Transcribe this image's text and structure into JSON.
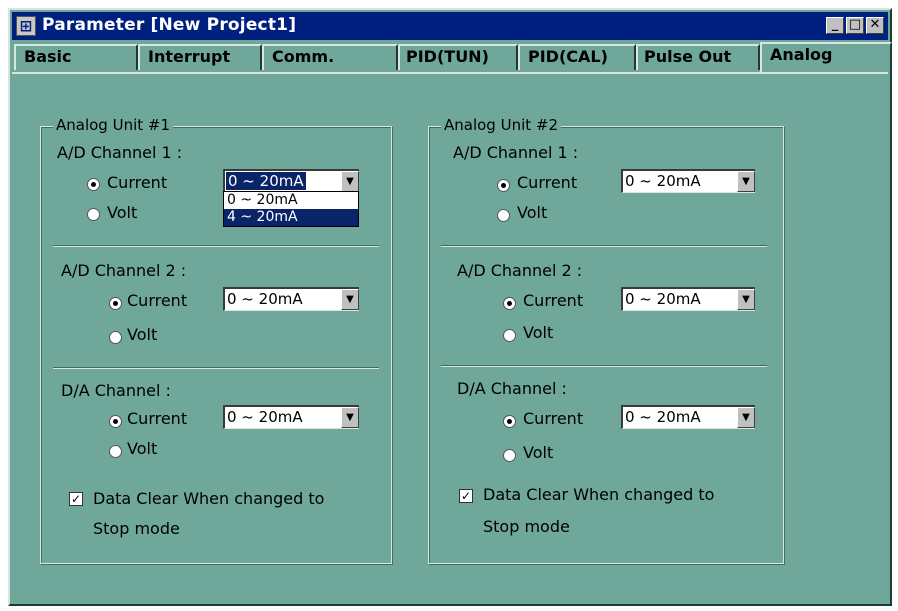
{
  "window": {
    "title": "Parameter [New Project1]",
    "app_icon": "grid-app-icon",
    "buttons": {
      "minimize": "_",
      "maximize": "□",
      "close": "✕"
    }
  },
  "tabs": [
    {
      "label": "Basic"
    },
    {
      "label": "Interrupt"
    },
    {
      "label": "Comm."
    },
    {
      "label": "PID(TUN)"
    },
    {
      "label": "PID(CAL)"
    },
    {
      "label": "Pulse Out"
    },
    {
      "label": "Analog",
      "active": true
    }
  ],
  "unit1": {
    "title": "Analog Unit #1",
    "ad1": {
      "heading": "A/D Channel 1 :",
      "current": "Current",
      "volt": "Volt",
      "range": "0 ~ 20mA",
      "dropdown": [
        "0 ~ 20mA",
        "4 ~ 20mA"
      ]
    },
    "ad2": {
      "heading": "A/D Channel 2 :",
      "current": "Current",
      "volt": "Volt",
      "range": "0 ~ 20mA"
    },
    "da": {
      "heading": "D/A  Channel :",
      "current": "Current",
      "volt": "Volt",
      "range": "0 ~ 20mA"
    },
    "clear": {
      "line1": "Data Clear When changed to",
      "line2": "Stop mode",
      "checked": true
    }
  },
  "unit2": {
    "title": "Analog Unit #2",
    "ad1": {
      "heading": "A/D  Channel 1 :",
      "current": "Current",
      "volt": "Volt",
      "range": "0 ~ 20mA"
    },
    "ad2": {
      "heading": "A/D  Channel 2 :",
      "current": "Current",
      "volt": "Volt",
      "range": "0 ~ 20mA"
    },
    "da": {
      "heading": "D/A  Channel  :",
      "current": "Current",
      "volt": "Volt",
      "range": "0 ~ 20mA"
    },
    "clear": {
      "line1": "Data Clear When changed to",
      "line2": "Stop mode",
      "checked": true
    }
  },
  "colors": {
    "face": "#6fa89a",
    "titlebar": "#002080",
    "highlight": "#0a246a"
  }
}
